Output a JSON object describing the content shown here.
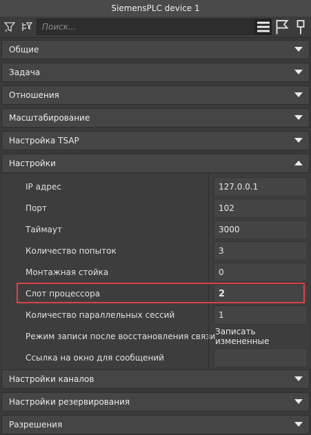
{
  "window": {
    "title": "SiemensPLC device 1"
  },
  "toolbar": {
    "search_placeholder": "Поиск...",
    "left_icons": [
      "filter-icon",
      "tree-filter-icon"
    ],
    "right_icons": [
      "list-view-icon",
      "flag-icon",
      "pin-icon"
    ]
  },
  "sections_top": [
    {
      "label": "Общие",
      "expanded": false
    },
    {
      "label": "Задача",
      "expanded": false
    },
    {
      "label": "Отношения",
      "expanded": false
    },
    {
      "label": "Масштабирование",
      "expanded": false
    },
    {
      "label": "Настройка TSAP",
      "expanded": false
    },
    {
      "label": "Настройки",
      "expanded": true
    }
  ],
  "settings_rows": [
    {
      "label": "IP адрес",
      "value": "127.0.0.1"
    },
    {
      "label": "Порт",
      "value": "102"
    },
    {
      "label": "Таймаут",
      "value": "3000"
    },
    {
      "label": "Количество попыток",
      "value": "3"
    },
    {
      "label": "Монтажная стойка",
      "value": "0"
    },
    {
      "label": "Слот процессора",
      "value": "2"
    },
    {
      "label": "Количество параллельных сессий",
      "value": "1"
    },
    {
      "label": "Режим записи после восстановления связи",
      "value": "Записать измененные"
    },
    {
      "label": "Ссылка на окно для сообщений",
      "value": ""
    }
  ],
  "sections_bottom": [
    {
      "label": "Настройки каналов",
      "expanded": false
    },
    {
      "label": "Настройки резервирования",
      "expanded": false
    },
    {
      "label": "Разрешения",
      "expanded": false
    }
  ],
  "colors": {
    "highlight": "#d9434a",
    "panel": "#3a3a3a",
    "section": "#454545"
  }
}
